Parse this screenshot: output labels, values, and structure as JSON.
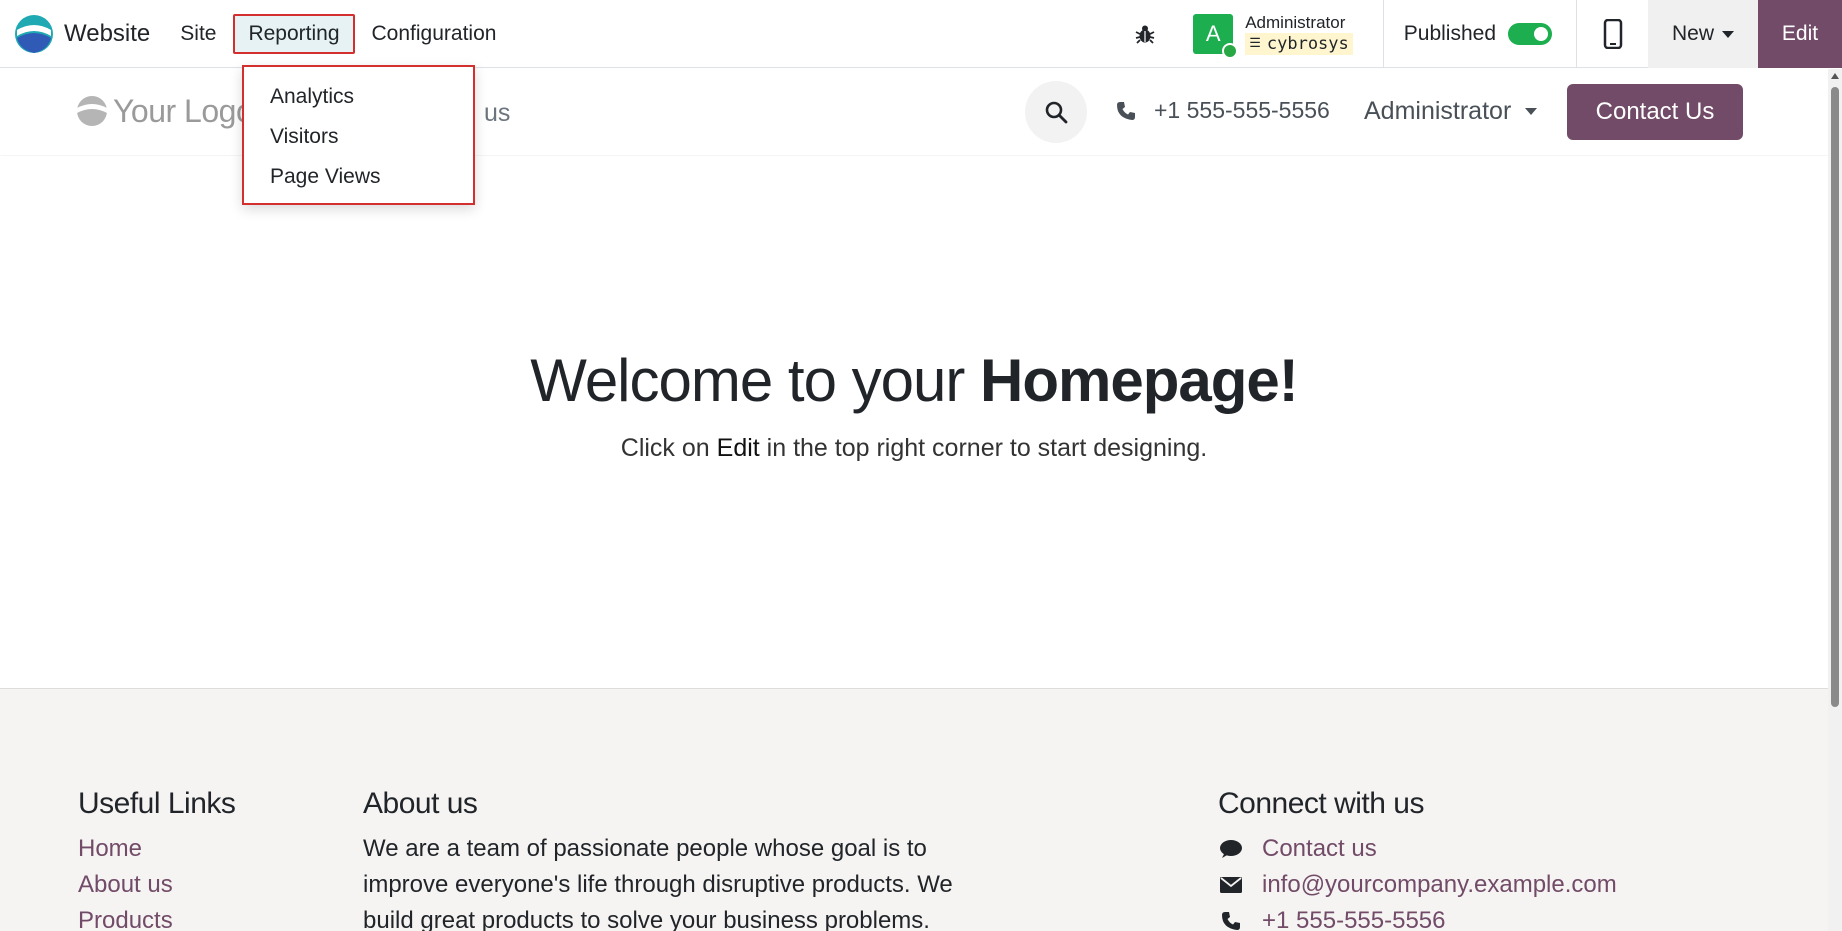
{
  "topbar": {
    "app_name": "Website",
    "menu": [
      "Site",
      "Reporting",
      "Configuration"
    ],
    "active_menu": "Reporting",
    "user": {
      "avatar_letter": "A",
      "name": "Administrator",
      "database": "cybrosys"
    },
    "published_label": "Published",
    "published": true,
    "new_label": "New",
    "edit_label": "Edit"
  },
  "reporting_dropdown": {
    "items": [
      "Analytics",
      "Visitors",
      "Page Views"
    ]
  },
  "site_header": {
    "logo_text": "Your Logo",
    "nav_partial": "us",
    "phone": "+1 555-555-5556",
    "user_menu": "Administrator",
    "contact_button": "Contact Us"
  },
  "hero": {
    "title_prefix": "Welcome to your ",
    "title_bold": "Homepage",
    "title_suffix": "!",
    "subtitle_prefix": "Click on ",
    "subtitle_bold": "Edit",
    "subtitle_suffix": " in the top right corner to start designing."
  },
  "footer": {
    "useful_links": {
      "heading": "Useful Links",
      "links": [
        "Home",
        "About us",
        "Products"
      ]
    },
    "about": {
      "heading": "About us",
      "lines": [
        "We are a team of passionate people whose goal is to",
        "improve everyone's life through disruptive products. We",
        "build great products to solve your business problems."
      ]
    },
    "connect": {
      "heading": "Connect with us",
      "items": [
        {
          "icon": "comment-icon",
          "text": "Contact us"
        },
        {
          "icon": "envelope-icon",
          "text": "info@yourcompany.example.com"
        },
        {
          "icon": "phone-icon",
          "text": "+1 555-555-5556"
        }
      ]
    }
  },
  "colors": {
    "brand": "#714b67",
    "success": "#1cae4f",
    "highlight_border": "#d32f2f"
  }
}
